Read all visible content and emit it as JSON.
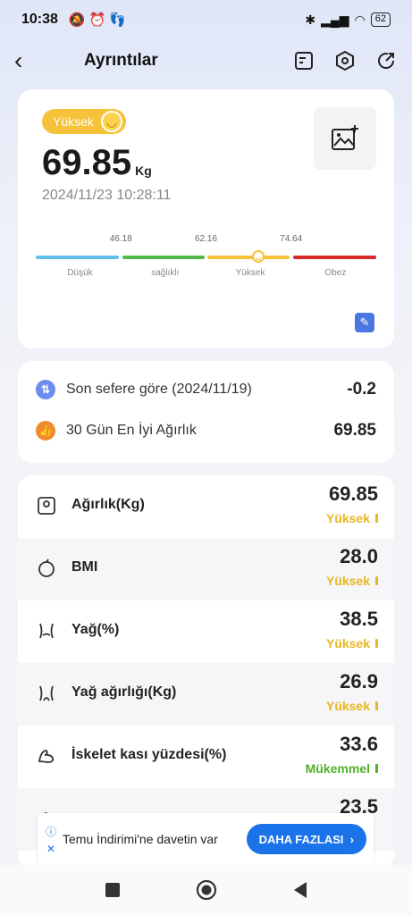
{
  "status": {
    "time": "10:38",
    "battery": "62"
  },
  "header": {
    "title": "Ayrıntılar"
  },
  "summary": {
    "badge": "Yüksek",
    "weight": "69.85",
    "unit": "Kg",
    "datetime": "2024/11/23 10:28:11",
    "scale": {
      "ticks": [
        "46.18",
        "62.16",
        "74.64"
      ],
      "labels": [
        "Düşük",
        "sağlıklı",
        "Yüksek",
        "Obez"
      ]
    }
  },
  "compare": {
    "row1_label": "Son sefere göre (2024/11/19)",
    "row1_value": "-0.2",
    "row2_label": "30 Gün En İyi Ağırlık",
    "row2_value": "69.85"
  },
  "metrics": [
    {
      "name": "Ağırlık(Kg)",
      "value": "69.85",
      "status": "Yüksek"
    },
    {
      "name": "BMI",
      "value": "28.0",
      "status": "Yüksek"
    },
    {
      "name": "Yağ(%)",
      "value": "38.5",
      "status": "Yüksek"
    },
    {
      "name": "Yağ ağırlığı(Kg)",
      "value": "26.9",
      "status": "Yüksek"
    },
    {
      "name": "İskelet kası yüzdesi(%)",
      "value": "33.6",
      "status": "Mükemmel"
    },
    {
      "name": "",
      "value": "23.5",
      "status": ""
    }
  ],
  "colors": {
    "yuksek": "#e8b620",
    "mukemmel": "#52b02a",
    "low": "#5ec0e8",
    "healthy": "#52b84a",
    "high": "#f5c23a",
    "obese": "#d82a2a"
  },
  "ad": {
    "text": "Temu İndirimi'ne davetin var",
    "button": "DAHA FAZLASI"
  }
}
